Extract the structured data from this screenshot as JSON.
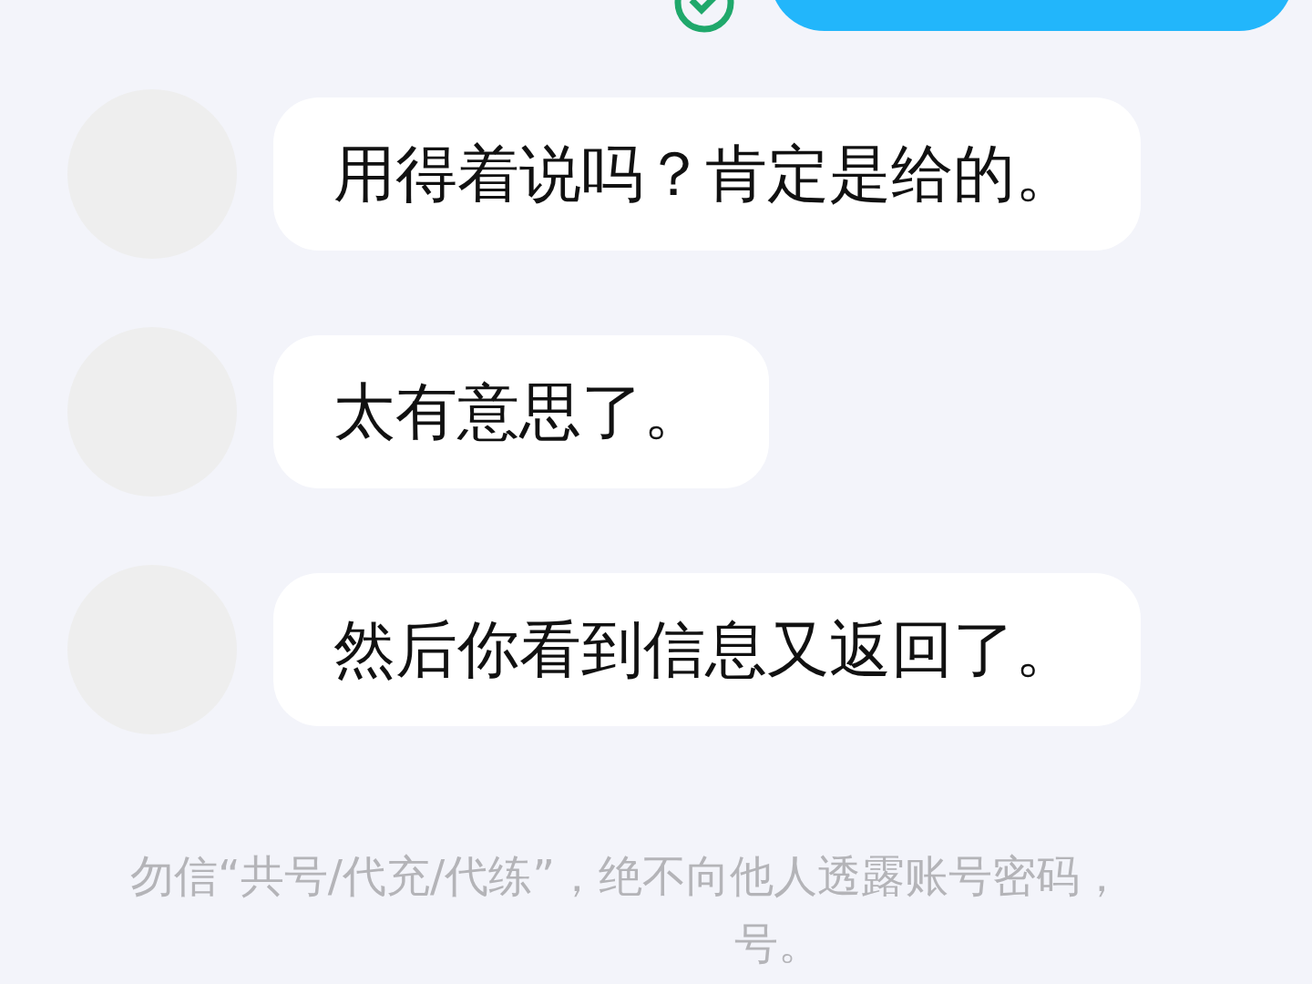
{
  "top_message": {
    "read": true
  },
  "messages": [
    {
      "text": "用得着说吗？肯定是给的。"
    },
    {
      "text": "太有意思了。"
    },
    {
      "text": "然后你看到信息又返回了。"
    }
  ],
  "notice": {
    "lines": [
      "勿信“共号/代充/代练”，绝不向他人透露账号密码，",
      "号。"
    ]
  }
}
